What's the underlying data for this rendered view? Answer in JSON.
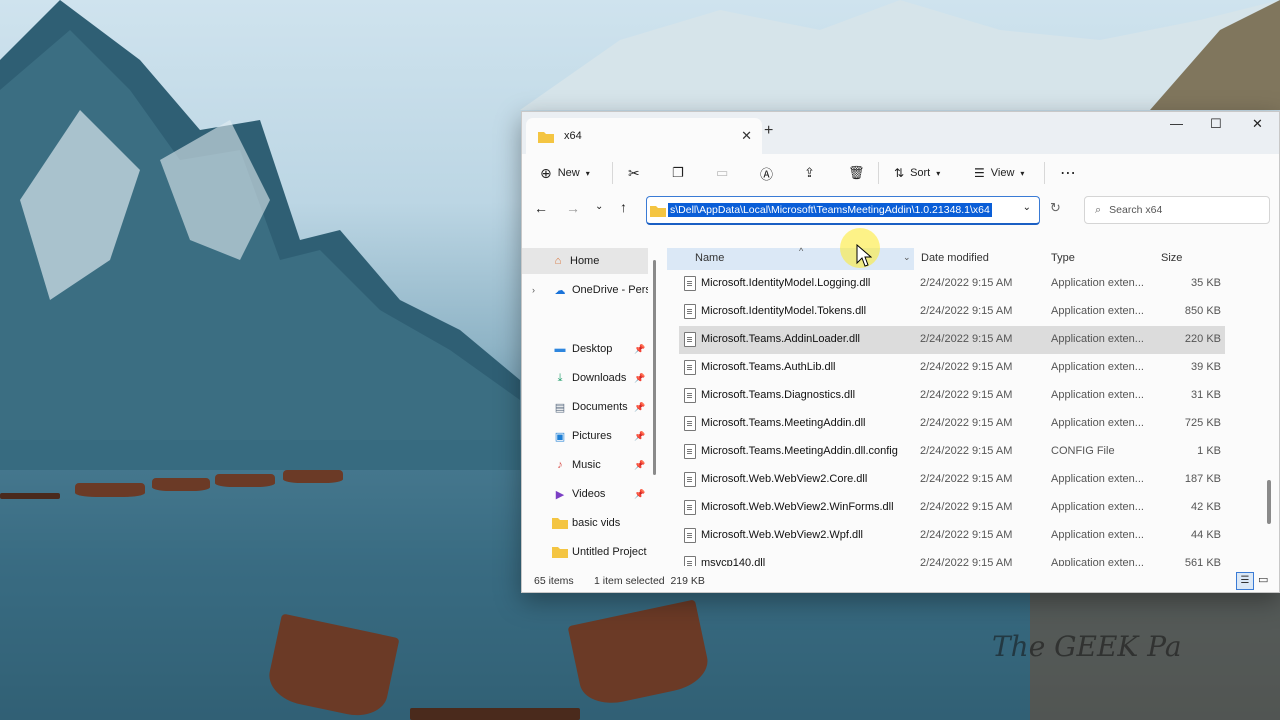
{
  "window": {
    "tab_title": "x64",
    "address": "s\\Dell\\AppData\\Local\\Microsoft\\TeamsMeetingAddin\\1.0.21348.1\\x64",
    "search_placeholder": "Search x64"
  },
  "toolbar": {
    "new_label": "New",
    "sort_label": "Sort",
    "view_label": "View"
  },
  "sidebar": {
    "items": [
      {
        "label": "Home"
      },
      {
        "label": "OneDrive - Pers"
      },
      {
        "label": "Desktop"
      },
      {
        "label": "Downloads"
      },
      {
        "label": "Documents"
      },
      {
        "label": "Pictures"
      },
      {
        "label": "Music"
      },
      {
        "label": "Videos"
      },
      {
        "label": "basic vids"
      },
      {
        "label": "Untitled Project"
      }
    ]
  },
  "columns": {
    "name": "Name",
    "date": "Date modified",
    "type": "Type",
    "size": "Size"
  },
  "files": [
    {
      "name": "Microsoft.IdentityModel.Logging.dll",
      "date": "2/24/2022 9:15 AM",
      "type": "Application exten...",
      "size": "35 KB"
    },
    {
      "name": "Microsoft.IdentityModel.Tokens.dll",
      "date": "2/24/2022 9:15 AM",
      "type": "Application exten...",
      "size": "850 KB"
    },
    {
      "name": "Microsoft.Teams.AddinLoader.dll",
      "date": "2/24/2022 9:15 AM",
      "type": "Application exten...",
      "size": "220 KB"
    },
    {
      "name": "Microsoft.Teams.AuthLib.dll",
      "date": "2/24/2022 9:15 AM",
      "type": "Application exten...",
      "size": "39 KB"
    },
    {
      "name": "Microsoft.Teams.Diagnostics.dll",
      "date": "2/24/2022 9:15 AM",
      "type": "Application exten...",
      "size": "31 KB"
    },
    {
      "name": "Microsoft.Teams.MeetingAddin.dll",
      "date": "2/24/2022 9:15 AM",
      "type": "Application exten...",
      "size": "725 KB"
    },
    {
      "name": "Microsoft.Teams.MeetingAddin.dll.config",
      "date": "2/24/2022 9:15 AM",
      "type": "CONFIG File",
      "size": "1 KB"
    },
    {
      "name": "Microsoft.Web.WebView2.Core.dll",
      "date": "2/24/2022 9:15 AM",
      "type": "Application exten...",
      "size": "187 KB"
    },
    {
      "name": "Microsoft.Web.WebView2.WinForms.dll",
      "date": "2/24/2022 9:15 AM",
      "type": "Application exten...",
      "size": "42 KB"
    },
    {
      "name": "Microsoft.Web.WebView2.Wpf.dll",
      "date": "2/24/2022 9:15 AM",
      "type": "Application exten...",
      "size": "44 KB"
    },
    {
      "name": "msvcp140.dll",
      "date": "2/24/2022 9:15 AM",
      "type": "Application exten...",
      "size": "561 KB"
    }
  ],
  "status": {
    "count": "65 items",
    "selection": "1 item selected  219 KB"
  },
  "watermark": "The GEEK Pa",
  "colors": {
    "accent": "#0a5ed7",
    "folder": "#f4c542"
  }
}
